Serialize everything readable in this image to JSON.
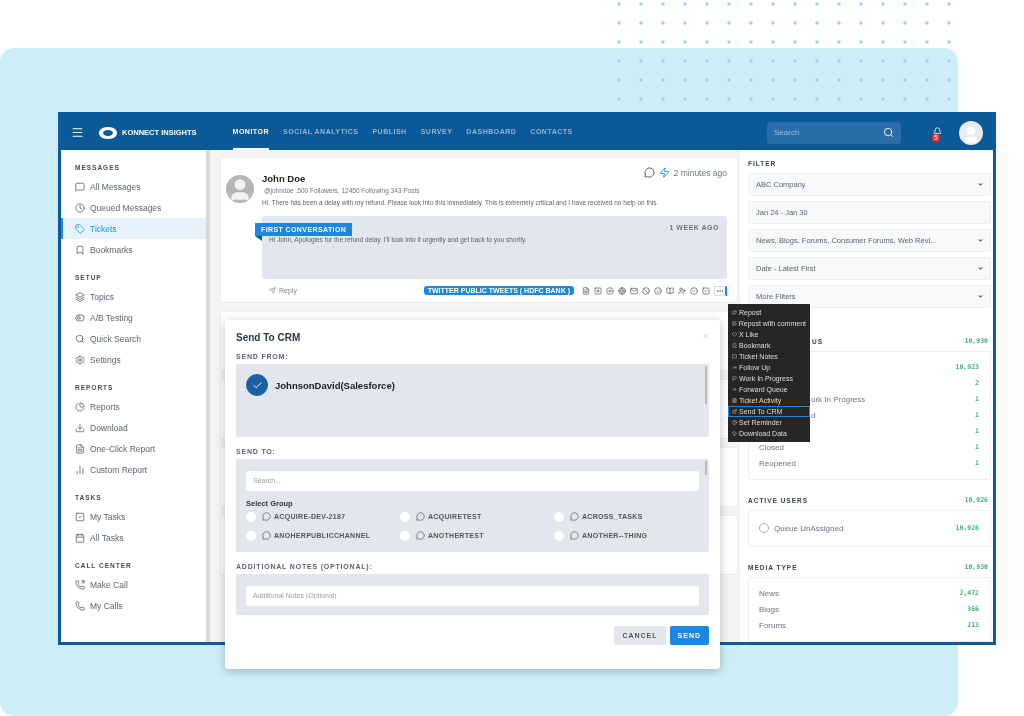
{
  "header": {
    "brand": "KONNECT INSIGHTS",
    "nav": [
      {
        "label": "MONITOR",
        "selected": true
      },
      {
        "label": "SOCIAL ANALYTICS",
        "selected": false
      },
      {
        "label": "PUBLISH",
        "selected": false
      },
      {
        "label": "SURVEY",
        "selected": false
      },
      {
        "label": "DASHBOARD",
        "selected": false
      },
      {
        "label": "CONTACTS",
        "selected": false
      }
    ],
    "search": {
      "placeholder": "Search"
    },
    "notifications": "5"
  },
  "sidebar": {
    "sections": [
      {
        "title": "MESSAGES",
        "items": [
          {
            "label": "All Messages",
            "selected": false
          },
          {
            "label": "Queued Messages",
            "selected": false
          },
          {
            "label": "Tickets",
            "selected": true
          },
          {
            "label": "Bookmarks",
            "selected": false
          }
        ]
      },
      {
        "title": "SETUP",
        "items": [
          {
            "label": "Topics",
            "selected": false
          },
          {
            "label": "A/B Testing",
            "selected": false
          },
          {
            "label": "Quick Search",
            "selected": false
          },
          {
            "label": "Settings",
            "selected": false
          }
        ]
      },
      {
        "title": "REPORTS",
        "items": [
          {
            "label": "Reports",
            "selected": false
          },
          {
            "label": "Download",
            "selected": false
          },
          {
            "label": "One-Click Report",
            "selected": false
          },
          {
            "label": "Custom Report",
            "selected": false
          }
        ]
      },
      {
        "title": "TASKS",
        "items": [
          {
            "label": "My Tasks",
            "selected": false
          },
          {
            "label": "All Tasks",
            "selected": false
          }
        ]
      },
      {
        "title": "CALL CENTER",
        "items": [
          {
            "label": "Make Call",
            "selected": false
          },
          {
            "label": "My Calls",
            "selected": false
          }
        ]
      }
    ]
  },
  "post": {
    "author": "John Doe",
    "meta": "@johndoe .500 Followers. 12450 Following 343 Posts",
    "time": "2 minutes ago",
    "text": "Hi, There has been a delay with my refund. Please look into this immediately. This is extremely critical and I have received no help on this.",
    "conversation": {
      "badge": "FIRST CONVERSATION",
      "time": "1 WEEK AGO",
      "text": "Hi John, Apologies for the refund delay. I'll look into it urgently and get back to you shortly."
    },
    "reply": "Reply",
    "source": "TWITTER PUBLIC TWEETS ( HDFC BANK )"
  },
  "context_menu": [
    {
      "label": "Repost",
      "selected": false
    },
    {
      "label": "Repost with comment",
      "selected": false
    },
    {
      "label": "X Like",
      "selected": false
    },
    {
      "label": "Bookmark",
      "selected": false
    },
    {
      "label": "Ticket Notes",
      "selected": false
    },
    {
      "label": "Follow Up",
      "selected": false
    },
    {
      "label": "Work In Progress",
      "selected": false
    },
    {
      "label": "Forward Queue",
      "selected": false
    },
    {
      "label": "Ticket Activity",
      "selected": false
    },
    {
      "label": "Send To CRM",
      "selected": true
    },
    {
      "label": "Set Reminder",
      "selected": false
    },
    {
      "label": "Download Data",
      "selected": false
    }
  ],
  "filter": {
    "title": "FILTER",
    "fields": [
      {
        "value": "ABC Company",
        "dropdown": true
      },
      {
        "value": "Jan 24 - Jan 30",
        "dropdown": false
      },
      {
        "value": "News, Blogs, Forums, Consumer Forums, Web Revi...",
        "dropdown": true
      },
      {
        "value": "Date - Latest First",
        "dropdown": true
      },
      {
        "value": "More Filters",
        "dropdown": true
      }
    ]
  },
  "status": {
    "title": "US",
    "total": "10,930",
    "rows": [
      {
        "count": "10,923"
      },
      {
        "count": "2"
      },
      {
        "label": "ork In Progress",
        "count": "1"
      },
      {
        "label": "d",
        "count": "1"
      },
      {
        "count": "1"
      },
      {
        "label": "Closed",
        "count": "1"
      },
      {
        "label": "Reopened",
        "count": "1"
      }
    ]
  },
  "active_users": {
    "title": "ACTIVE USERS",
    "total": "10,926",
    "rows": [
      {
        "label": "Queue UnAssigned",
        "count": "10,926",
        "selected": false
      }
    ]
  },
  "media_type": {
    "title": "MEDIA TYPE",
    "total": "10,930",
    "rows": [
      {
        "label": "News",
        "count": "2,472"
      },
      {
        "label": "Blogs",
        "count": "366"
      },
      {
        "label": "Forums",
        "count": "213"
      }
    ]
  },
  "modal": {
    "title": "Send To CRM",
    "from_label": "SEND FROM:",
    "account": {
      "name": "JohnsonDavid(Salesforce)",
      "checked": true
    },
    "to_label": "SEND TO:",
    "search": {
      "placeholder": "Search..."
    },
    "group_title": "Select Group",
    "groups": [
      {
        "label": "ACQUIRE-DEV-2187",
        "selected": false
      },
      {
        "label": "ACQUIRETEST",
        "selected": false
      },
      {
        "label": "ACROSS_TASKS",
        "selected": false
      },
      {
        "label": "ANOHERPUBLICCHANNEL",
        "selected": false
      },
      {
        "label": "ANOTHERTEST",
        "selected": false
      },
      {
        "label": "ANOTHER--THING",
        "selected": false
      }
    ],
    "notes_label": "ADDITIONAL NOTES (OPTIONAL):",
    "notes": {
      "placeholder": "Additional Notes (Optional)"
    },
    "buttons": [
      {
        "label": "CANCEL",
        "kind": "secondary"
      },
      {
        "label": "SEND",
        "kind": "primary"
      }
    ]
  }
}
